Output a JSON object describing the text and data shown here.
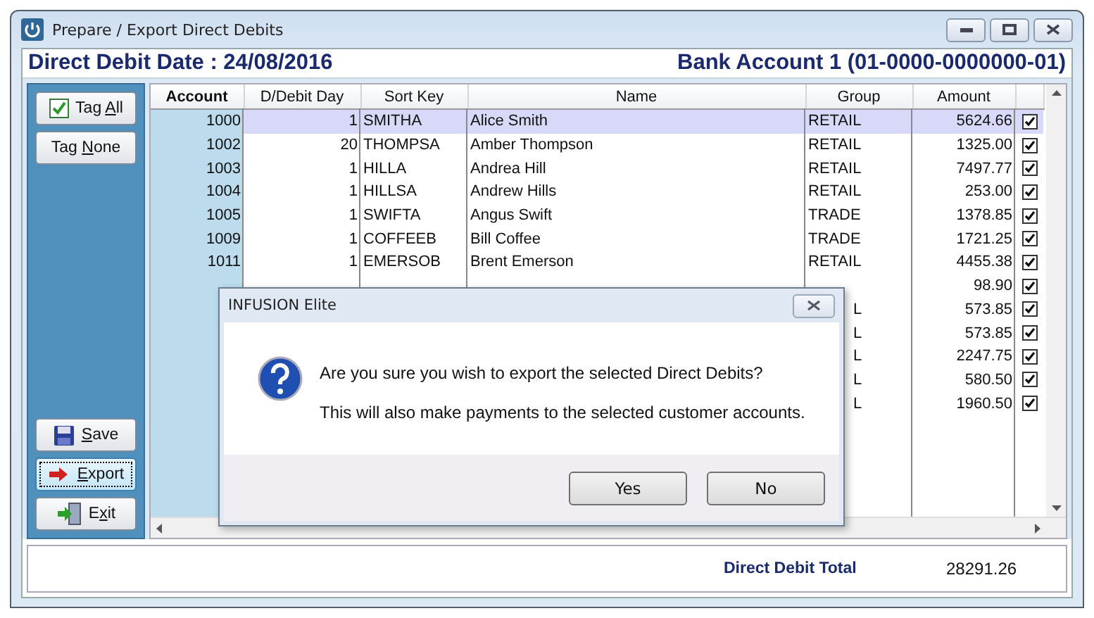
{
  "window": {
    "title": "Prepare / Export Direct Debits"
  },
  "header": {
    "date_label": "Direct Debit Date : 24/08/2016",
    "bank_account": "Bank Account 1 (01-0000-0000000-01)"
  },
  "side_buttons": [
    {
      "kind": "check",
      "before": "Tag ",
      "key": "A",
      "after": "ll",
      "focused": false
    },
    {
      "kind": "none",
      "before": "Tag ",
      "key": "N",
      "after": "one",
      "focused": false
    },
    {
      "kind": "save",
      "key": "S",
      "after": "ave",
      "focused": false
    },
    {
      "kind": "export",
      "key": "E",
      "after": "xport",
      "focused": true
    },
    {
      "kind": "exit",
      "before": "E",
      "key": "x",
      "after": "it",
      "focused": false
    }
  ],
  "table": {
    "columns": [
      "Account",
      "D/Debit Day",
      "Sort Key",
      "Name",
      "Group",
      "Amount"
    ],
    "rows": [
      {
        "kind": "full",
        "selected": true,
        "account": "1000",
        "day": "1",
        "sort_key": "SMITHA",
        "name": "Alice Smith",
        "group": "RETAIL",
        "amount": "5624.66",
        "tagged": true
      },
      {
        "kind": "full",
        "selected": false,
        "account": "1002",
        "day": "20",
        "sort_key": "THOMPSA",
        "name": "Amber Thompson",
        "group": "RETAIL",
        "amount": "1325.00",
        "tagged": true
      },
      {
        "kind": "full",
        "selected": false,
        "account": "1003",
        "day": "1",
        "sort_key": "HILLA",
        "name": "Andrea Hill",
        "group": "RETAIL",
        "amount": "7497.77",
        "tagged": true
      },
      {
        "kind": "full",
        "selected": false,
        "account": "1004",
        "day": "1",
        "sort_key": "HILLSA",
        "name": "Andrew Hills",
        "group": "RETAIL",
        "amount": "253.00",
        "tagged": true
      },
      {
        "kind": "full",
        "selected": false,
        "account": "1005",
        "day": "1",
        "sort_key": "SWIFTA",
        "name": "Angus Swift",
        "group": "TRADE",
        "amount": "1378.85",
        "tagged": true
      },
      {
        "kind": "full",
        "selected": false,
        "account": "1009",
        "day": "1",
        "sort_key": "COFFEEB",
        "name": "Bill Coffee",
        "group": "TRADE",
        "amount": "1721.25",
        "tagged": true
      },
      {
        "kind": "full",
        "selected": false,
        "account": "1011",
        "day": "1",
        "sort_key": "EMERSOB",
        "name": "Brent Emerson",
        "group": "RETAIL",
        "amount": "4455.38",
        "tagged": true
      },
      {
        "kind": "covered",
        "selected": false,
        "amount": "98.90",
        "tagged": true
      },
      {
        "kind": "covered",
        "selected": false,
        "group": "L",
        "amount": "573.85",
        "tagged": true
      },
      {
        "kind": "covered",
        "selected": false,
        "group": "L",
        "amount": "573.85",
        "tagged": true
      },
      {
        "kind": "covered",
        "selected": false,
        "group": "L",
        "amount": "2247.75",
        "tagged": true
      },
      {
        "kind": "covered",
        "selected": false,
        "group": "L",
        "amount": "580.50",
        "tagged": true
      },
      {
        "kind": "covered",
        "selected": false,
        "group": "L",
        "amount": "1960.50",
        "tagged": true
      }
    ]
  },
  "footer": {
    "total_label": "Direct Debit Total",
    "total": "28291.26"
  },
  "dialog": {
    "title": "INFUSION Elite",
    "message": "Are you sure you wish to export the selected Direct Debits?",
    "detail": "This will also make payments to the selected customer accounts.",
    "buttons": [
      "Yes",
      "No"
    ]
  }
}
